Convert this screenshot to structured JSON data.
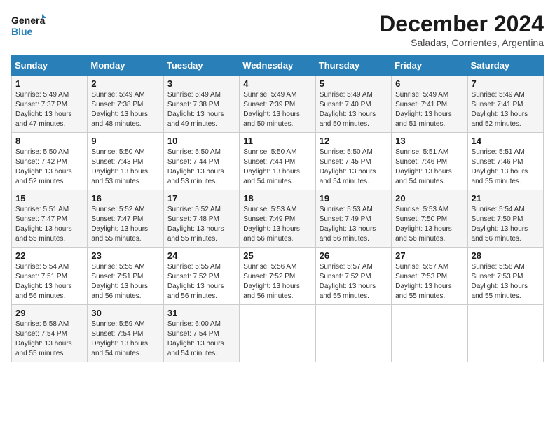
{
  "logo": {
    "line1": "General",
    "line2": "Blue"
  },
  "title": "December 2024",
  "subtitle": "Saladas, Corrientes, Argentina",
  "weekdays": [
    "Sunday",
    "Monday",
    "Tuesday",
    "Wednesday",
    "Thursday",
    "Friday",
    "Saturday"
  ],
  "weeks": [
    [
      {
        "day": "1",
        "info": "Sunrise: 5:49 AM\nSunset: 7:37 PM\nDaylight: 13 hours and 47 minutes."
      },
      {
        "day": "2",
        "info": "Sunrise: 5:49 AM\nSunset: 7:38 PM\nDaylight: 13 hours and 48 minutes."
      },
      {
        "day": "3",
        "info": "Sunrise: 5:49 AM\nSunset: 7:38 PM\nDaylight: 13 hours and 49 minutes."
      },
      {
        "day": "4",
        "info": "Sunrise: 5:49 AM\nSunset: 7:39 PM\nDaylight: 13 hours and 50 minutes."
      },
      {
        "day": "5",
        "info": "Sunrise: 5:49 AM\nSunset: 7:40 PM\nDaylight: 13 hours and 50 minutes."
      },
      {
        "day": "6",
        "info": "Sunrise: 5:49 AM\nSunset: 7:41 PM\nDaylight: 13 hours and 51 minutes."
      },
      {
        "day": "7",
        "info": "Sunrise: 5:49 AM\nSunset: 7:41 PM\nDaylight: 13 hours and 52 minutes."
      }
    ],
    [
      {
        "day": "8",
        "info": "Sunrise: 5:50 AM\nSunset: 7:42 PM\nDaylight: 13 hours and 52 minutes."
      },
      {
        "day": "9",
        "info": "Sunrise: 5:50 AM\nSunset: 7:43 PM\nDaylight: 13 hours and 53 minutes."
      },
      {
        "day": "10",
        "info": "Sunrise: 5:50 AM\nSunset: 7:44 PM\nDaylight: 13 hours and 53 minutes."
      },
      {
        "day": "11",
        "info": "Sunrise: 5:50 AM\nSunset: 7:44 PM\nDaylight: 13 hours and 54 minutes."
      },
      {
        "day": "12",
        "info": "Sunrise: 5:50 AM\nSunset: 7:45 PM\nDaylight: 13 hours and 54 minutes."
      },
      {
        "day": "13",
        "info": "Sunrise: 5:51 AM\nSunset: 7:46 PM\nDaylight: 13 hours and 54 minutes."
      },
      {
        "day": "14",
        "info": "Sunrise: 5:51 AM\nSunset: 7:46 PM\nDaylight: 13 hours and 55 minutes."
      }
    ],
    [
      {
        "day": "15",
        "info": "Sunrise: 5:51 AM\nSunset: 7:47 PM\nDaylight: 13 hours and 55 minutes."
      },
      {
        "day": "16",
        "info": "Sunrise: 5:52 AM\nSunset: 7:47 PM\nDaylight: 13 hours and 55 minutes."
      },
      {
        "day": "17",
        "info": "Sunrise: 5:52 AM\nSunset: 7:48 PM\nDaylight: 13 hours and 55 minutes."
      },
      {
        "day": "18",
        "info": "Sunrise: 5:53 AM\nSunset: 7:49 PM\nDaylight: 13 hours and 56 minutes."
      },
      {
        "day": "19",
        "info": "Sunrise: 5:53 AM\nSunset: 7:49 PM\nDaylight: 13 hours and 56 minutes."
      },
      {
        "day": "20",
        "info": "Sunrise: 5:53 AM\nSunset: 7:50 PM\nDaylight: 13 hours and 56 minutes."
      },
      {
        "day": "21",
        "info": "Sunrise: 5:54 AM\nSunset: 7:50 PM\nDaylight: 13 hours and 56 minutes."
      }
    ],
    [
      {
        "day": "22",
        "info": "Sunrise: 5:54 AM\nSunset: 7:51 PM\nDaylight: 13 hours and 56 minutes."
      },
      {
        "day": "23",
        "info": "Sunrise: 5:55 AM\nSunset: 7:51 PM\nDaylight: 13 hours and 56 minutes."
      },
      {
        "day": "24",
        "info": "Sunrise: 5:55 AM\nSunset: 7:52 PM\nDaylight: 13 hours and 56 minutes."
      },
      {
        "day": "25",
        "info": "Sunrise: 5:56 AM\nSunset: 7:52 PM\nDaylight: 13 hours and 56 minutes."
      },
      {
        "day": "26",
        "info": "Sunrise: 5:57 AM\nSunset: 7:52 PM\nDaylight: 13 hours and 55 minutes."
      },
      {
        "day": "27",
        "info": "Sunrise: 5:57 AM\nSunset: 7:53 PM\nDaylight: 13 hours and 55 minutes."
      },
      {
        "day": "28",
        "info": "Sunrise: 5:58 AM\nSunset: 7:53 PM\nDaylight: 13 hours and 55 minutes."
      }
    ],
    [
      {
        "day": "29",
        "info": "Sunrise: 5:58 AM\nSunset: 7:54 PM\nDaylight: 13 hours and 55 minutes."
      },
      {
        "day": "30",
        "info": "Sunrise: 5:59 AM\nSunset: 7:54 PM\nDaylight: 13 hours and 54 minutes."
      },
      {
        "day": "31",
        "info": "Sunrise: 6:00 AM\nSunset: 7:54 PM\nDaylight: 13 hours and 54 minutes."
      },
      null,
      null,
      null,
      null
    ]
  ]
}
